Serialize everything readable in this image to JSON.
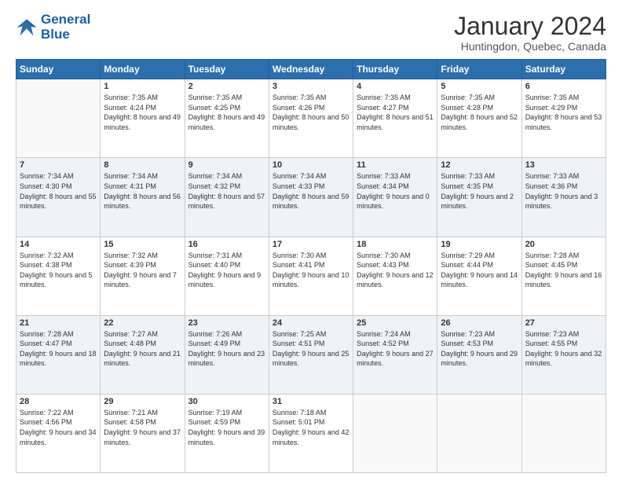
{
  "header": {
    "logo_line1": "General",
    "logo_line2": "Blue",
    "title": "January 2024",
    "subtitle": "Huntingdon, Quebec, Canada"
  },
  "days_of_week": [
    "Sunday",
    "Monday",
    "Tuesday",
    "Wednesday",
    "Thursday",
    "Friday",
    "Saturday"
  ],
  "weeks": [
    [
      {
        "day": "",
        "sunrise": "",
        "sunset": "",
        "daylight": ""
      },
      {
        "day": "1",
        "sunrise": "Sunrise: 7:35 AM",
        "sunset": "Sunset: 4:24 PM",
        "daylight": "Daylight: 8 hours and 49 minutes."
      },
      {
        "day": "2",
        "sunrise": "Sunrise: 7:35 AM",
        "sunset": "Sunset: 4:25 PM",
        "daylight": "Daylight: 8 hours and 49 minutes."
      },
      {
        "day": "3",
        "sunrise": "Sunrise: 7:35 AM",
        "sunset": "Sunset: 4:26 PM",
        "daylight": "Daylight: 8 hours and 50 minutes."
      },
      {
        "day": "4",
        "sunrise": "Sunrise: 7:35 AM",
        "sunset": "Sunset: 4:27 PM",
        "daylight": "Daylight: 8 hours and 51 minutes."
      },
      {
        "day": "5",
        "sunrise": "Sunrise: 7:35 AM",
        "sunset": "Sunset: 4:28 PM",
        "daylight": "Daylight: 8 hours and 52 minutes."
      },
      {
        "day": "6",
        "sunrise": "Sunrise: 7:35 AM",
        "sunset": "Sunset: 4:29 PM",
        "daylight": "Daylight: 8 hours and 53 minutes."
      }
    ],
    [
      {
        "day": "7",
        "sunrise": "Sunrise: 7:34 AM",
        "sunset": "Sunset: 4:30 PM",
        "daylight": "Daylight: 8 hours and 55 minutes."
      },
      {
        "day": "8",
        "sunrise": "Sunrise: 7:34 AM",
        "sunset": "Sunset: 4:31 PM",
        "daylight": "Daylight: 8 hours and 56 minutes."
      },
      {
        "day": "9",
        "sunrise": "Sunrise: 7:34 AM",
        "sunset": "Sunset: 4:32 PM",
        "daylight": "Daylight: 8 hours and 57 minutes."
      },
      {
        "day": "10",
        "sunrise": "Sunrise: 7:34 AM",
        "sunset": "Sunset: 4:33 PM",
        "daylight": "Daylight: 8 hours and 59 minutes."
      },
      {
        "day": "11",
        "sunrise": "Sunrise: 7:33 AM",
        "sunset": "Sunset: 4:34 PM",
        "daylight": "Daylight: 9 hours and 0 minutes."
      },
      {
        "day": "12",
        "sunrise": "Sunrise: 7:33 AM",
        "sunset": "Sunset: 4:35 PM",
        "daylight": "Daylight: 9 hours and 2 minutes."
      },
      {
        "day": "13",
        "sunrise": "Sunrise: 7:33 AM",
        "sunset": "Sunset: 4:36 PM",
        "daylight": "Daylight: 9 hours and 3 minutes."
      }
    ],
    [
      {
        "day": "14",
        "sunrise": "Sunrise: 7:32 AM",
        "sunset": "Sunset: 4:38 PM",
        "daylight": "Daylight: 9 hours and 5 minutes."
      },
      {
        "day": "15",
        "sunrise": "Sunrise: 7:32 AM",
        "sunset": "Sunset: 4:39 PM",
        "daylight": "Daylight: 9 hours and 7 minutes."
      },
      {
        "day": "16",
        "sunrise": "Sunrise: 7:31 AM",
        "sunset": "Sunset: 4:40 PM",
        "daylight": "Daylight: 9 hours and 9 minutes."
      },
      {
        "day": "17",
        "sunrise": "Sunrise: 7:30 AM",
        "sunset": "Sunset: 4:41 PM",
        "daylight": "Daylight: 9 hours and 10 minutes."
      },
      {
        "day": "18",
        "sunrise": "Sunrise: 7:30 AM",
        "sunset": "Sunset: 4:43 PM",
        "daylight": "Daylight: 9 hours and 12 minutes."
      },
      {
        "day": "19",
        "sunrise": "Sunrise: 7:29 AM",
        "sunset": "Sunset: 4:44 PM",
        "daylight": "Daylight: 9 hours and 14 minutes."
      },
      {
        "day": "20",
        "sunrise": "Sunrise: 7:28 AM",
        "sunset": "Sunset: 4:45 PM",
        "daylight": "Daylight: 9 hours and 16 minutes."
      }
    ],
    [
      {
        "day": "21",
        "sunrise": "Sunrise: 7:28 AM",
        "sunset": "Sunset: 4:47 PM",
        "daylight": "Daylight: 9 hours and 18 minutes."
      },
      {
        "day": "22",
        "sunrise": "Sunrise: 7:27 AM",
        "sunset": "Sunset: 4:48 PM",
        "daylight": "Daylight: 9 hours and 21 minutes."
      },
      {
        "day": "23",
        "sunrise": "Sunrise: 7:26 AM",
        "sunset": "Sunset: 4:49 PM",
        "daylight": "Daylight: 9 hours and 23 minutes."
      },
      {
        "day": "24",
        "sunrise": "Sunrise: 7:25 AM",
        "sunset": "Sunset: 4:51 PM",
        "daylight": "Daylight: 9 hours and 25 minutes."
      },
      {
        "day": "25",
        "sunrise": "Sunrise: 7:24 AM",
        "sunset": "Sunset: 4:52 PM",
        "daylight": "Daylight: 9 hours and 27 minutes."
      },
      {
        "day": "26",
        "sunrise": "Sunrise: 7:23 AM",
        "sunset": "Sunset: 4:53 PM",
        "daylight": "Daylight: 9 hours and 29 minutes."
      },
      {
        "day": "27",
        "sunrise": "Sunrise: 7:23 AM",
        "sunset": "Sunset: 4:55 PM",
        "daylight": "Daylight: 9 hours and 32 minutes."
      }
    ],
    [
      {
        "day": "28",
        "sunrise": "Sunrise: 7:22 AM",
        "sunset": "Sunset: 4:56 PM",
        "daylight": "Daylight: 9 hours and 34 minutes."
      },
      {
        "day": "29",
        "sunrise": "Sunrise: 7:21 AM",
        "sunset": "Sunset: 4:58 PM",
        "daylight": "Daylight: 9 hours and 37 minutes."
      },
      {
        "day": "30",
        "sunrise": "Sunrise: 7:19 AM",
        "sunset": "Sunset: 4:59 PM",
        "daylight": "Daylight: 9 hours and 39 minutes."
      },
      {
        "day": "31",
        "sunrise": "Sunrise: 7:18 AM",
        "sunset": "Sunset: 5:01 PM",
        "daylight": "Daylight: 9 hours and 42 minutes."
      },
      {
        "day": "",
        "sunrise": "",
        "sunset": "",
        "daylight": ""
      },
      {
        "day": "",
        "sunrise": "",
        "sunset": "",
        "daylight": ""
      },
      {
        "day": "",
        "sunrise": "",
        "sunset": "",
        "daylight": ""
      }
    ]
  ]
}
